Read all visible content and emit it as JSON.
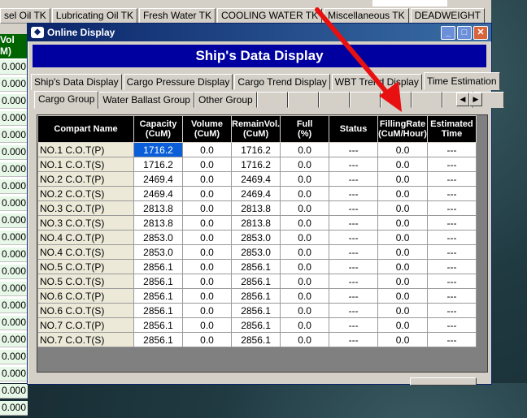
{
  "bg_tabs": [
    "sel Oil TK",
    "Lubricating Oil TK",
    "Fresh Water TK",
    "COOLING WATER TK",
    "Miscellaneous TK",
    "DEADWEIGHT"
  ],
  "bg_column": {
    "header_line1": "Vol",
    "header_line2": "M)",
    "values": [
      "0.000",
      "0.000",
      "0.000",
      "0.000",
      "0.000",
      "0.000",
      "0.000",
      "0.000",
      "0.000",
      "0.000",
      "0.000",
      "0.000",
      "0.000",
      "0.000",
      "0.000",
      "0.000",
      "0.000",
      "0.000",
      "0.000",
      "0.000",
      "0.000"
    ]
  },
  "window": {
    "title": "Online Display",
    "minimize": "_",
    "maximize": "□",
    "close": "✕"
  },
  "banner": "Ship's Data Display",
  "main_tabs": [
    {
      "label": "Ship's Data Display",
      "active": false
    },
    {
      "label": "Cargo Pressure Display",
      "active": false
    },
    {
      "label": "Cargo Trend Display",
      "active": false
    },
    {
      "label": "WBT Trend Display",
      "active": false
    },
    {
      "label": "Time Estimation",
      "active": true
    }
  ],
  "sub_tabs": [
    {
      "label": "Cargo Group",
      "active": true
    },
    {
      "label": "Water Ballast Group",
      "active": false
    },
    {
      "label": "Other Group",
      "active": false
    }
  ],
  "table": {
    "headers": [
      [
        "Compart Name"
      ],
      [
        "Capacity",
        "(CuM)"
      ],
      [
        "Volume",
        "(CuM)"
      ],
      [
        "RemainVol.",
        "(CuM)"
      ],
      [
        "Full",
        "(%)"
      ],
      [
        "Status"
      ],
      [
        "FillingRate",
        "(CuM/Hour)"
      ],
      [
        "Estimated",
        "Time"
      ]
    ],
    "rows": [
      [
        "NO.1 C.O.T(P)",
        "1716.2",
        "0.0",
        "1716.2",
        "0.0",
        "---",
        "0.0",
        "---"
      ],
      [
        "NO.1 C.O.T(S)",
        "1716.2",
        "0.0",
        "1716.2",
        "0.0",
        "---",
        "0.0",
        "---"
      ],
      [
        "NO.2 C.O.T(P)",
        "2469.4",
        "0.0",
        "2469.4",
        "0.0",
        "---",
        "0.0",
        "---"
      ],
      [
        "NO.2 C.O.T(S)",
        "2469.4",
        "0.0",
        "2469.4",
        "0.0",
        "---",
        "0.0",
        "---"
      ],
      [
        "NO.3 C.O.T(P)",
        "2813.8",
        "0.0",
        "2813.8",
        "0.0",
        "---",
        "0.0",
        "---"
      ],
      [
        "NO.3 C.O.T(S)",
        "2813.8",
        "0.0",
        "2813.8",
        "0.0",
        "---",
        "0.0",
        "---"
      ],
      [
        "NO.4 C.O.T(P)",
        "2853.0",
        "0.0",
        "2853.0",
        "0.0",
        "---",
        "0.0",
        "---"
      ],
      [
        "NO.4 C.O.T(S)",
        "2853.0",
        "0.0",
        "2853.0",
        "0.0",
        "---",
        "0.0",
        "---"
      ],
      [
        "NO.5 C.O.T(P)",
        "2856.1",
        "0.0",
        "2856.1",
        "0.0",
        "---",
        "0.0",
        "---"
      ],
      [
        "NO.5 C.O.T(S)",
        "2856.1",
        "0.0",
        "2856.1",
        "0.0",
        "---",
        "0.0",
        "---"
      ],
      [
        "NO.6 C.O.T(P)",
        "2856.1",
        "0.0",
        "2856.1",
        "0.0",
        "---",
        "0.0",
        "---"
      ],
      [
        "NO.6 C.O.T(S)",
        "2856.1",
        "0.0",
        "2856.1",
        "0.0",
        "---",
        "0.0",
        "---"
      ],
      [
        "NO.7 C.O.T(P)",
        "2856.1",
        "0.0",
        "2856.1",
        "0.0",
        "---",
        "0.0",
        "---"
      ],
      [
        "NO.7 C.O.T(S)",
        "2856.1",
        "0.0",
        "2856.1",
        "0.0",
        "---",
        "0.0",
        "---"
      ]
    ],
    "selected_cell": {
      "row": 0,
      "col": 1
    }
  },
  "colors": {
    "banner_bg": "#0000a0",
    "header_bg": "#000000",
    "selection": "#0a5fd8",
    "annotation_arrow": "#e81010",
    "bg_column_header": "#006400"
  }
}
